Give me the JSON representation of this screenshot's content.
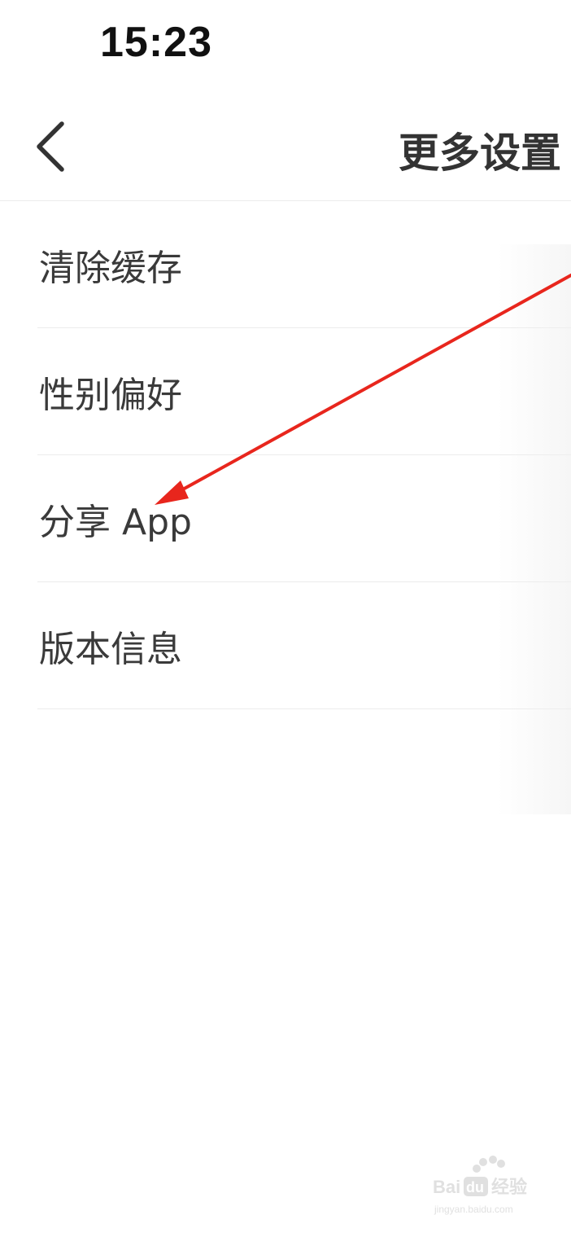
{
  "status_bar": {
    "time": "15:23"
  },
  "nav": {
    "title": "更多设置",
    "back_icon": "chevron-left-icon"
  },
  "settings": {
    "items": [
      {
        "label": "清除缓存"
      },
      {
        "label": "性别偏好"
      },
      {
        "label": "分享 App"
      },
      {
        "label": "版本信息"
      }
    ]
  },
  "annotation": {
    "arrow_color": "#e8261d",
    "points_to": "分享 App"
  },
  "watermark": {
    "brand": "Baidu 经验",
    "url": "jingyan.baidu.com"
  },
  "colors": {
    "text": "#333333",
    "divider": "#ececec",
    "background": "#ffffff"
  }
}
